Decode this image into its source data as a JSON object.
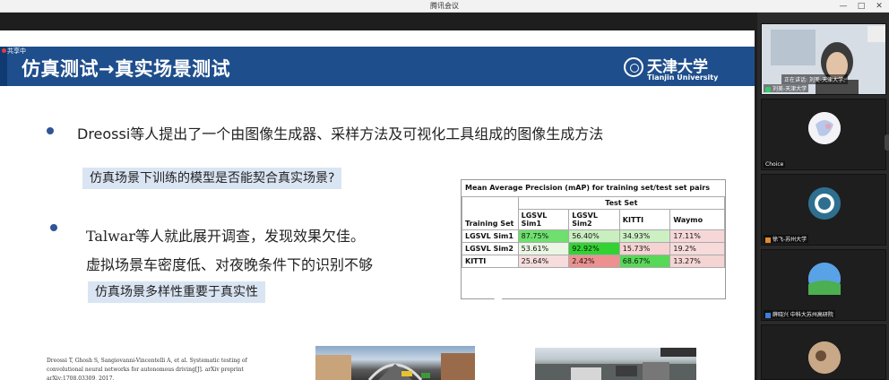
{
  "window": {
    "title": "腾讯会议",
    "controls": [
      "—",
      "□",
      "✕"
    ]
  },
  "slide": {
    "sharing_tag": "共享中",
    "title": "仿真测试→真实场景测试",
    "logo_cn": "天津大学",
    "logo_en": "Tianjin University",
    "bullet1": "Dreossi等人提出了一个由图像生成器、采样方法及可视化工具组成的图像生成方法",
    "callout1": "仿真场景下训练的模型是否能契合真实场景?",
    "bullet2": "Talwar等人就此展开调查，发现效果欠佳。",
    "line3": "虚拟场景车密度低、对夜晚条件下的识别不够",
    "callout2": "仿真场景多样性重要于真实性",
    "reference": "Dreossi T, Ghosh S, Sangiovanni-Vincentelli A, et al. Systematic testing of convolutional neural networks for autonomous driving[J]. arXiv preprint arXiv:1708.03309, 2017."
  },
  "table": {
    "caption": "Mean Average Precision (mAP) for training set/test set pairs",
    "test_set_label": "Test Set",
    "training_set_label": "Training Set",
    "columns": [
      "LGSVL Sim1",
      "LGSVL Sim2",
      "KITTI",
      "Waymo"
    ],
    "rows": [
      {
        "name": "LGSVL Sim1",
        "values": [
          "87.75%",
          "56.40%",
          "34.93%",
          "17.11%"
        ],
        "colors": [
          "#6de06d",
          "#c9efc0",
          "#ccf0c4",
          "#f6d7d7"
        ]
      },
      {
        "name": "LGSVL Sim2",
        "values": [
          "53.61%",
          "92.92%",
          "15.73%",
          "19.2%"
        ],
        "colors": [
          "#e9f6e4",
          "#33d233",
          "#f6d2d2",
          "#f7dada"
        ]
      },
      {
        "name": "KITTI",
        "values": [
          "25.64%",
          "2.42%",
          "68.67%",
          "13.27%"
        ],
        "colors": [
          "#f6dcdc",
          "#ec9090",
          "#57d857",
          "#f5d4d4"
        ]
      }
    ]
  },
  "participants": [
    {
      "label": "刘美-天津大学",
      "speaking": "正在讲话: 刘美-天津大学;",
      "mic": "green"
    },
    {
      "label": "Choice",
      "mic": "none"
    },
    {
      "label": "徐飞-苏州大学",
      "mic": "orange"
    },
    {
      "label": "薛晓兴 中科大苏州高研院",
      "mic": "blue"
    },
    {
      "label": "",
      "mic": "none"
    }
  ],
  "colors": {
    "header_blue": "#1f4e8c",
    "callout_bg": "#dae5f3",
    "bullet": "#2f5597"
  }
}
